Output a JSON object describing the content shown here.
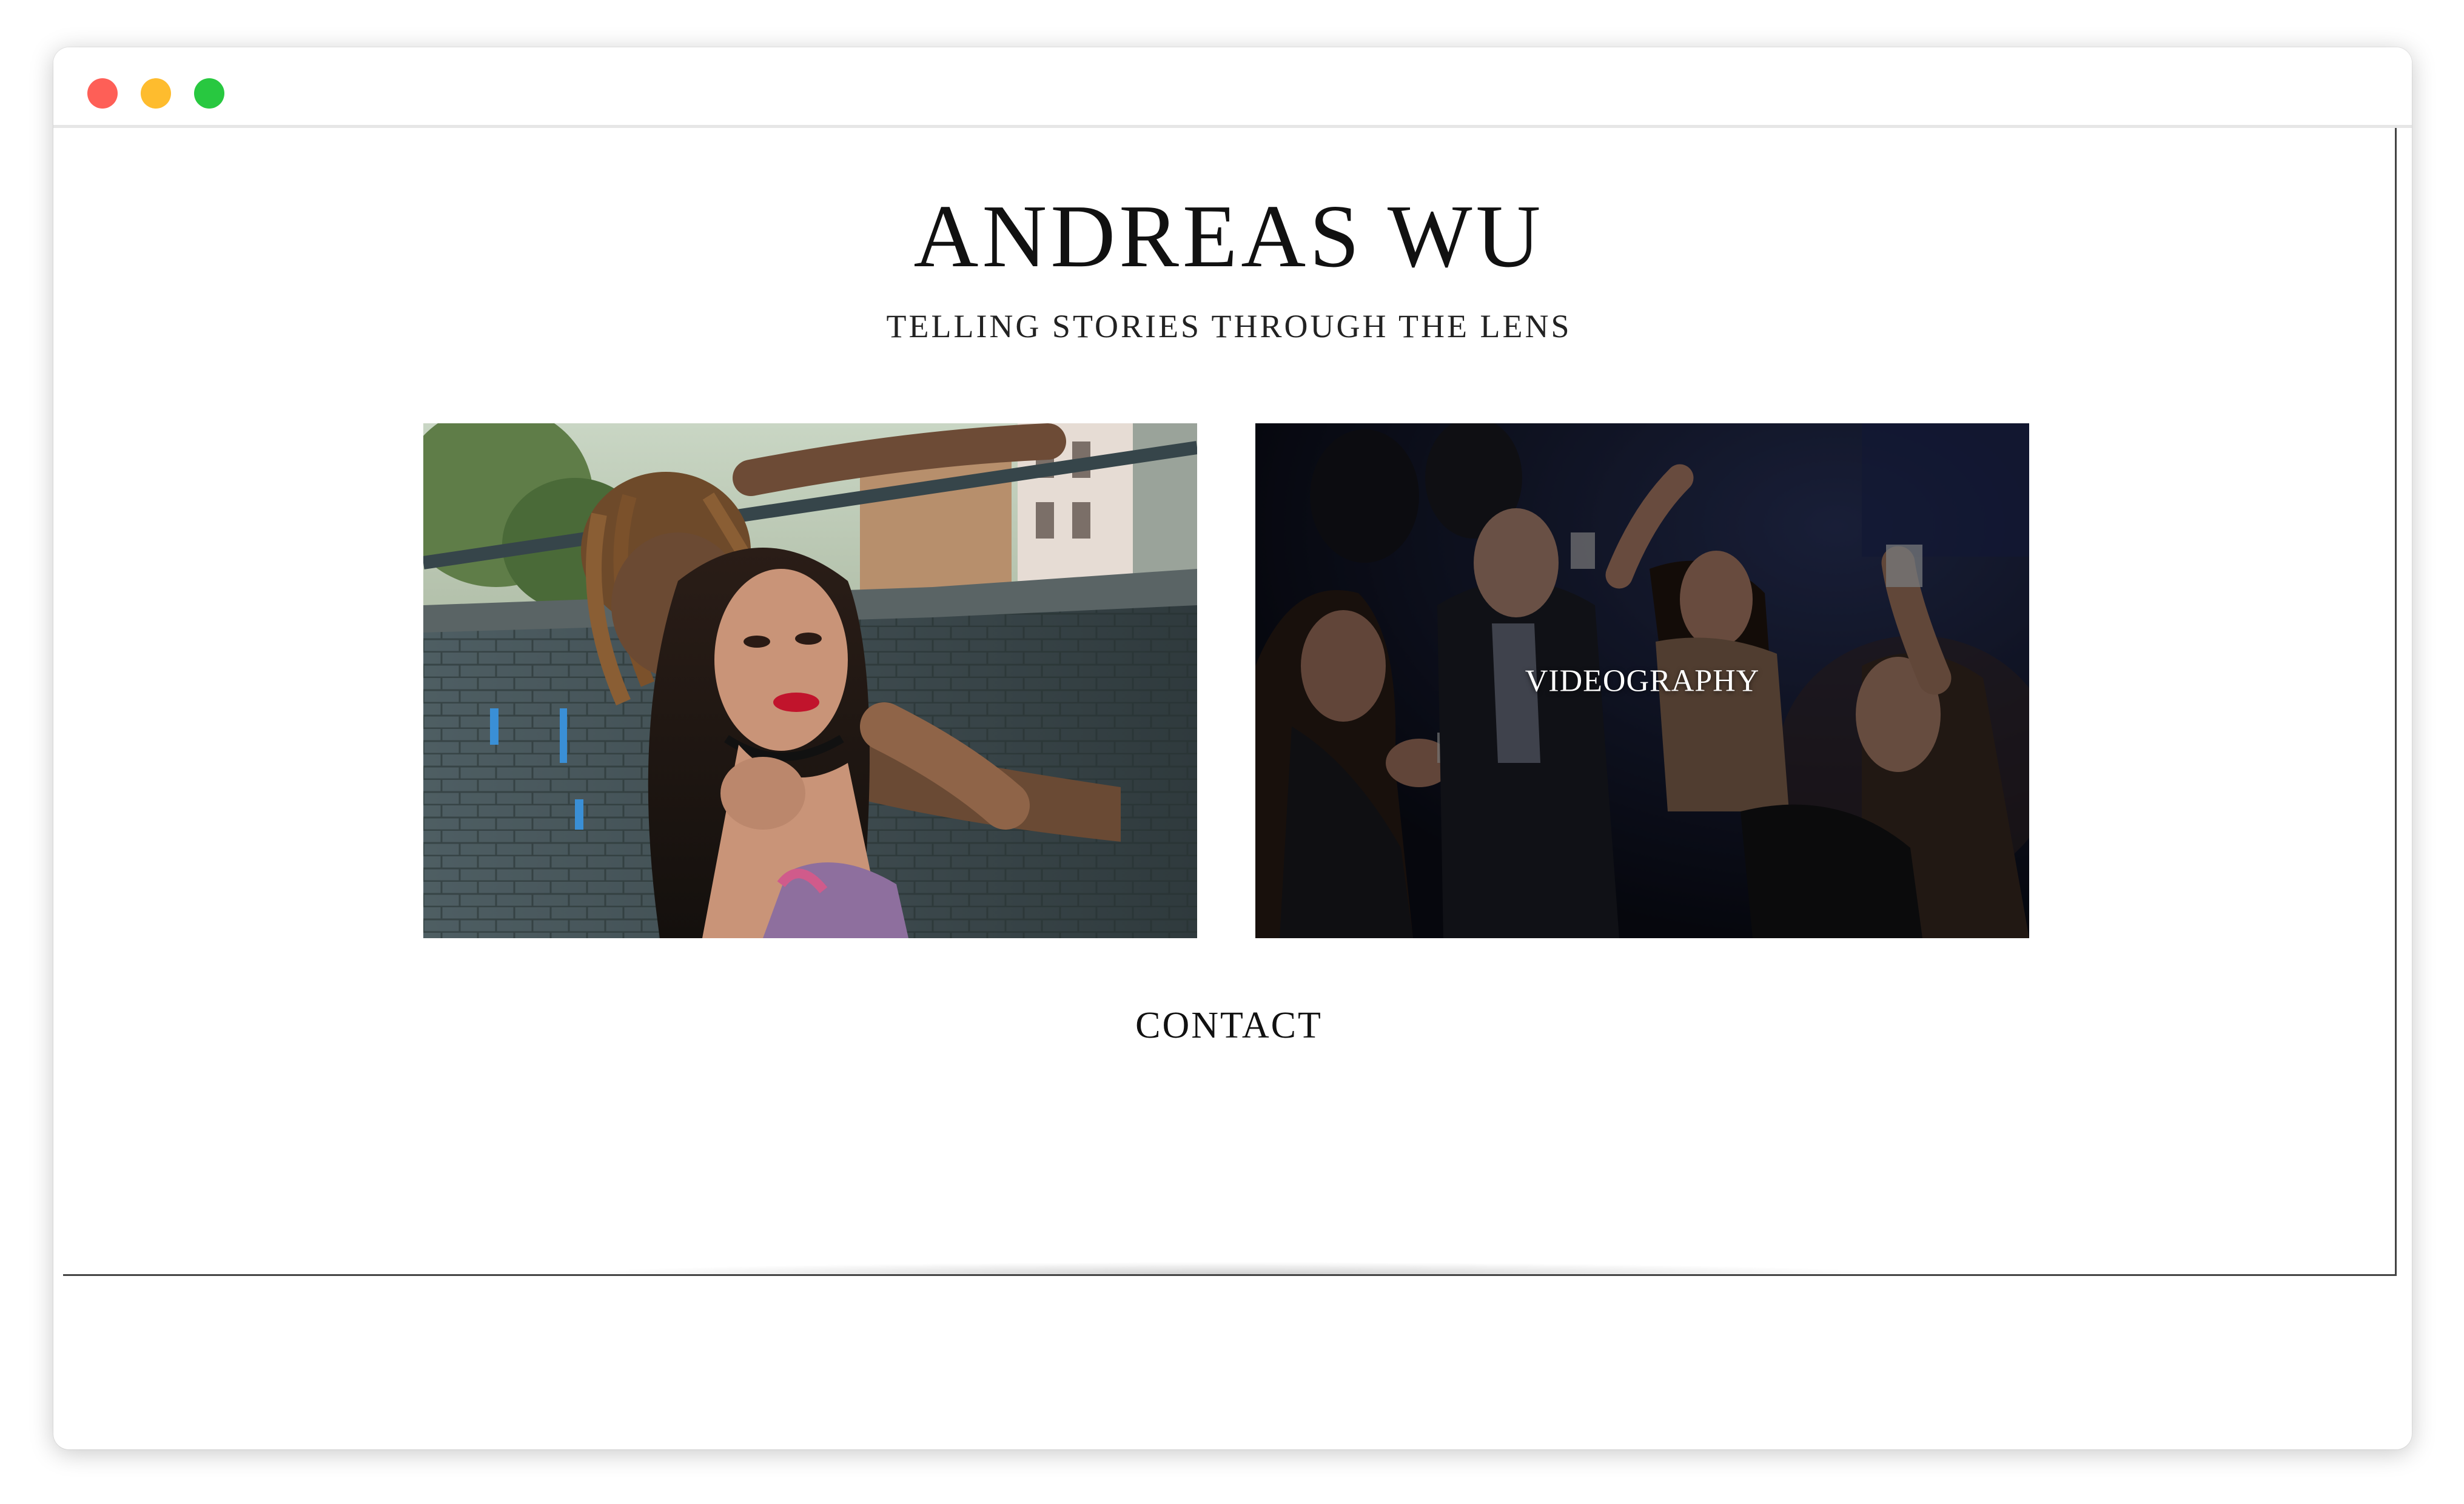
{
  "site": {
    "title": "ANDREAS WU",
    "tagline": "TELLING STORIES THROUGH THE LENS"
  },
  "gallery": {
    "tiles": [
      {
        "label": "",
        "image": "photography-portrait-photo"
      },
      {
        "label": "VIDEOGRAPHY",
        "image": "videography-party-photo"
      }
    ]
  },
  "nav": {
    "contact_label": "CONTACT"
  },
  "colors": {
    "window_close": "#fe5f57",
    "window_minimize": "#febc2e",
    "window_zoom": "#28c840",
    "text": "#111111",
    "background": "#ffffff"
  }
}
